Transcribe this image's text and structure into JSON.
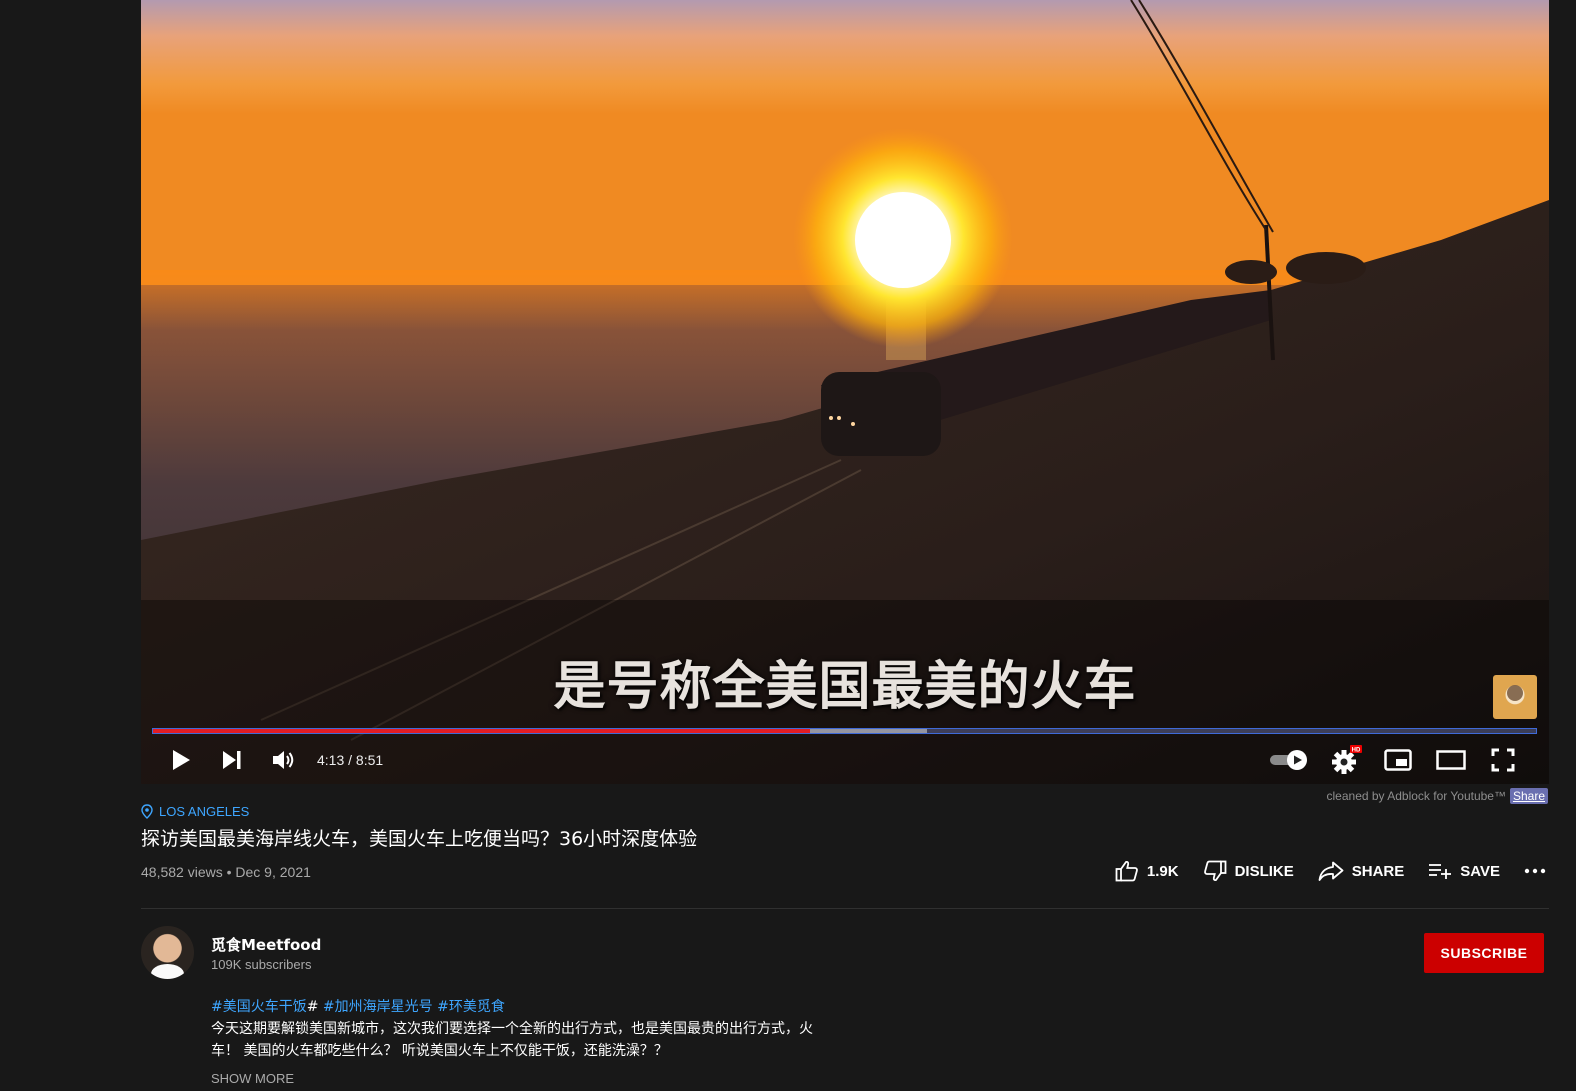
{
  "player": {
    "subtitle": "是号称全美国最美的火车",
    "current_time": "4:13",
    "duration": "8:51",
    "time_display": "4:13 / 8:51",
    "progress_fraction": 0.475,
    "buffered_fraction": 0.56,
    "settings_badge": "HD",
    "icons": [
      "play-icon",
      "next-icon",
      "volume-icon",
      "autoplay-toggle",
      "settings-icon",
      "miniplayer-icon",
      "theater-icon",
      "fullscreen-icon"
    ]
  },
  "adblock": {
    "text": "cleaned by Adblock for Youtube™",
    "share_label": "Share"
  },
  "video": {
    "location": "LOS ANGELES",
    "title": "探访美国最美海岸线火车，美国火车上吃便当吗？36小时深度体验",
    "meta": "48,582 views • Dec 9, 2021"
  },
  "actions": {
    "like": "1.9K",
    "dislike": "DISLIKE",
    "share": "SHARE",
    "save": "SAVE"
  },
  "channel": {
    "name": "觅食Meetfood",
    "subscribers": "109K subscribers",
    "subscribe_label": "SUBSCRIBE"
  },
  "description": {
    "tag1": "#美国火车干饭",
    "sep": "#",
    "tag2": " #加州海岸星光号",
    "tag3": " #环美觅食",
    "line1": "今天这期要解锁美国新城市，这次我们要选择一个全新的出行方式，也是美国最贵的出行方式，火",
    "line2": "车！ 美国的火车都吃些什么？ 听说美国火车上不仅能干饭，还能洗澡？？",
    "show_more": "SHOW MORE"
  },
  "colors": {
    "accent_blue": "#3ea6ff",
    "subscribe_red": "#cc0000",
    "progress_red": "#e21d25",
    "background": "#181818"
  }
}
